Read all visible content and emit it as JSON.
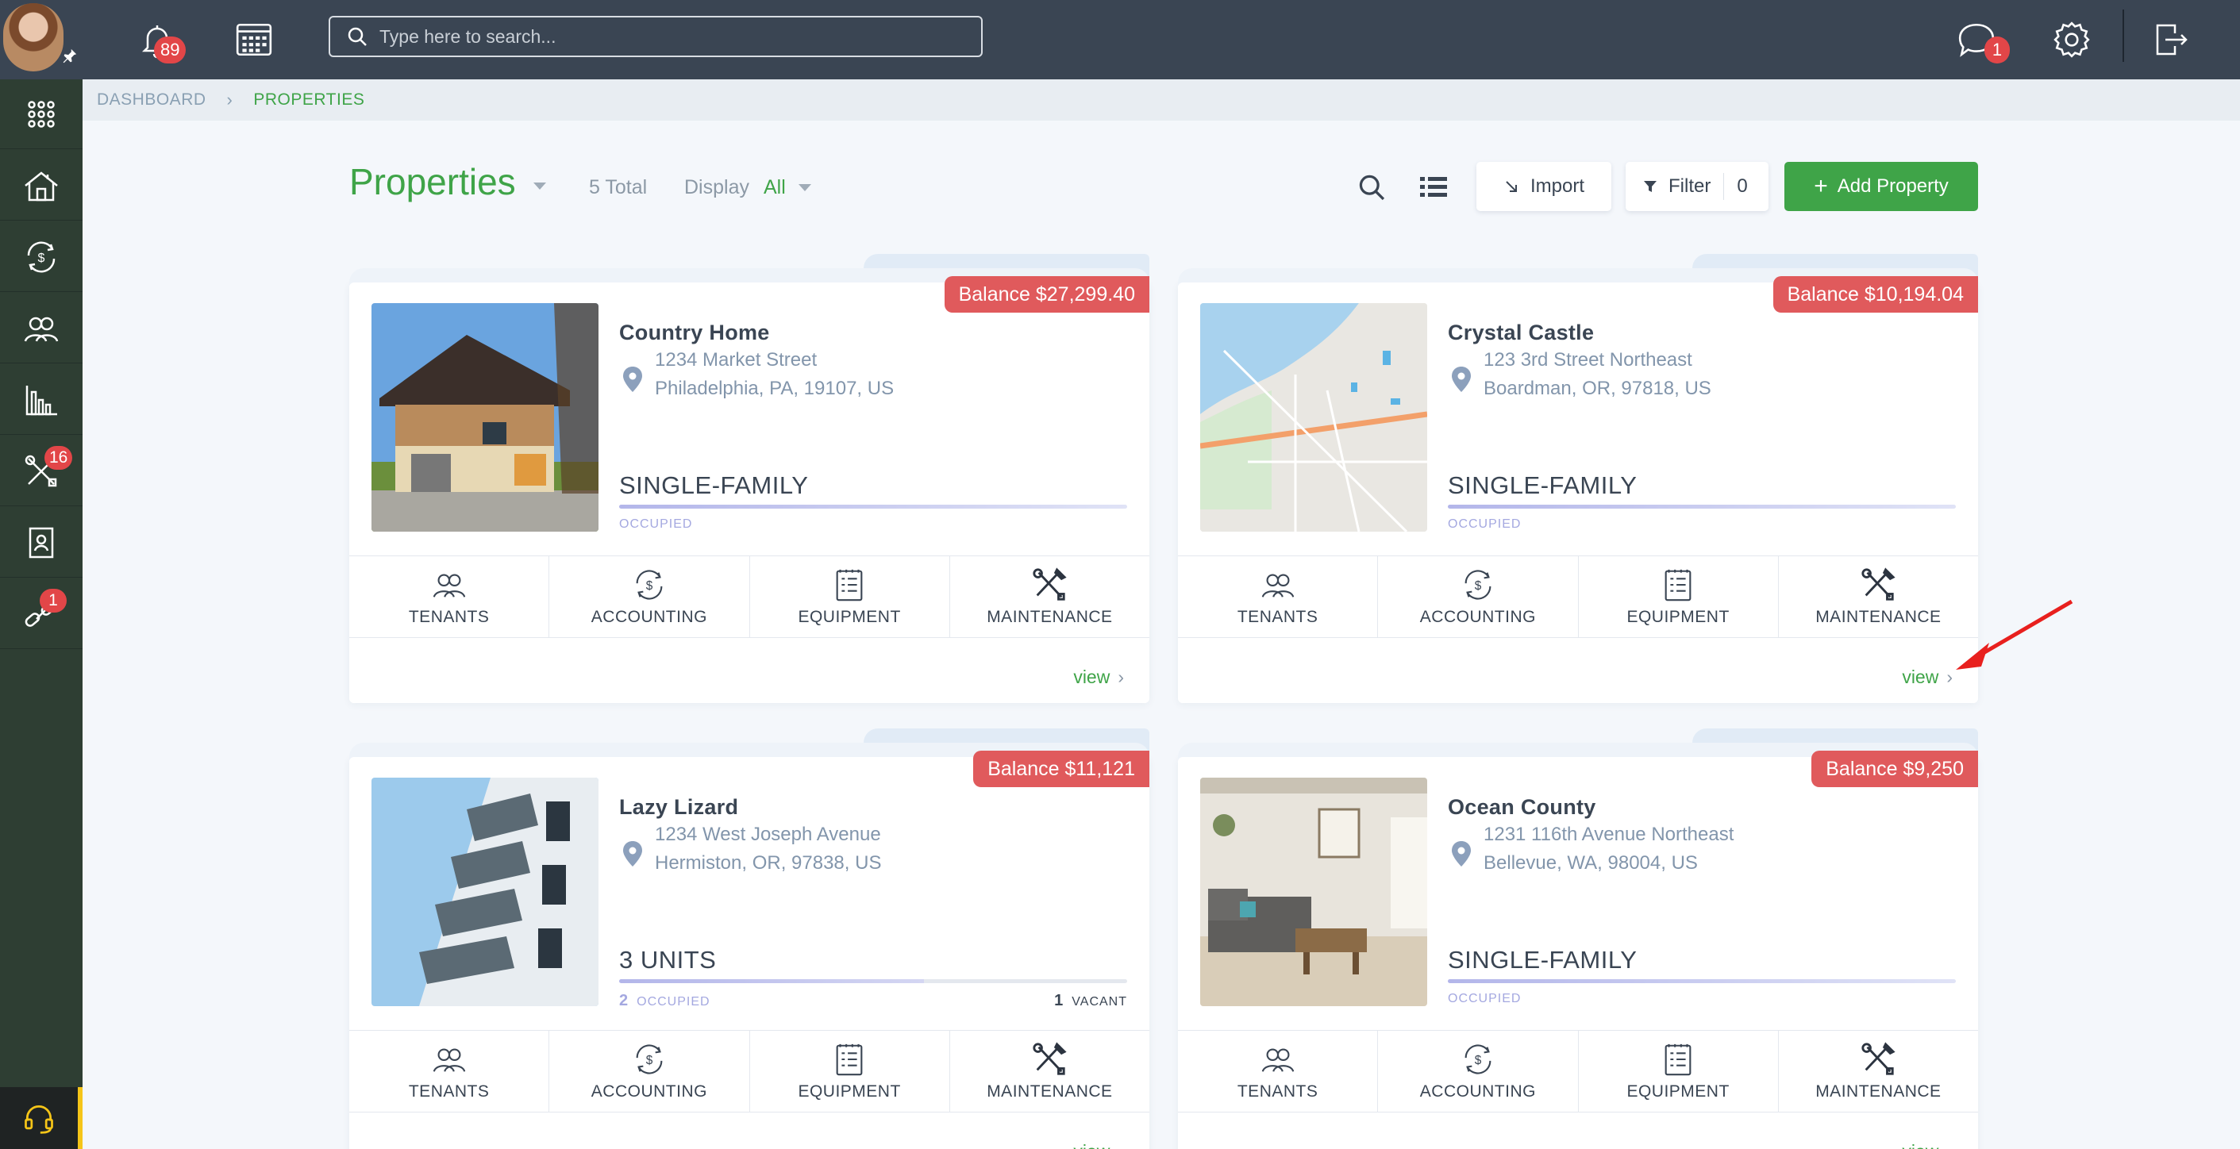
{
  "topbar": {
    "notifications_count": "89",
    "search_placeholder": "Type here to search...",
    "messages_count": "1"
  },
  "sidebar": {
    "maintenance_badge": "16",
    "integrations_badge": "1"
  },
  "breadcrumb": {
    "home": "DASHBOARD",
    "separator": "›",
    "current": "PROPERTIES"
  },
  "header": {
    "title": "Properties",
    "total": "5 Total",
    "display_label": "Display",
    "display_value": "All",
    "import_label": "Import",
    "filter_label": "Filter",
    "filter_count": "0",
    "add_label": "Add Property"
  },
  "actions": {
    "tenants": "TENANTS",
    "accounting": "ACCOUNTING",
    "equipment": "EQUIPMENT",
    "maintenance": "MAINTENANCE",
    "view": "view",
    "view_chevron": "›"
  },
  "properties": [
    {
      "balance": "Balance $27,299.40",
      "name": "Country Home",
      "address1": "1234 Market Street",
      "address2": "Philadelphia, PA, 19107, US",
      "type": "SINGLE-FAMILY",
      "occupied_label": "OCCUPIED"
    },
    {
      "balance": "Balance $10,194.04",
      "name": "Crystal Castle",
      "address1": "123 3rd Street Northeast",
      "address2": "Boardman, OR, 97818, US",
      "type": "SINGLE-FAMILY",
      "occupied_label": "OCCUPIED"
    },
    {
      "balance": "Balance $11,121",
      "name": "Lazy Lizard",
      "address1": "1234 West Joseph Avenue",
      "address2": "Hermiston, OR, 97838, US",
      "type": "3 UNITS",
      "occupied_count": "2",
      "occupied_label": "OCCUPIED",
      "vacant_count": "1",
      "vacant_label": "VACANT"
    },
    {
      "balance": "Balance $9,250",
      "name": "Ocean County",
      "address1": "1231 116th Avenue Northeast",
      "address2": "Bellevue, WA, 98004, US",
      "type": "SINGLE-FAMILY",
      "occupied_label": "OCCUPIED"
    }
  ],
  "colors": {
    "brand_green": "#3fa448",
    "topbar": "#3a4553",
    "sidebar": "#2e3e33",
    "badge_red": "#e24648",
    "balance_red": "#e05a5c"
  }
}
